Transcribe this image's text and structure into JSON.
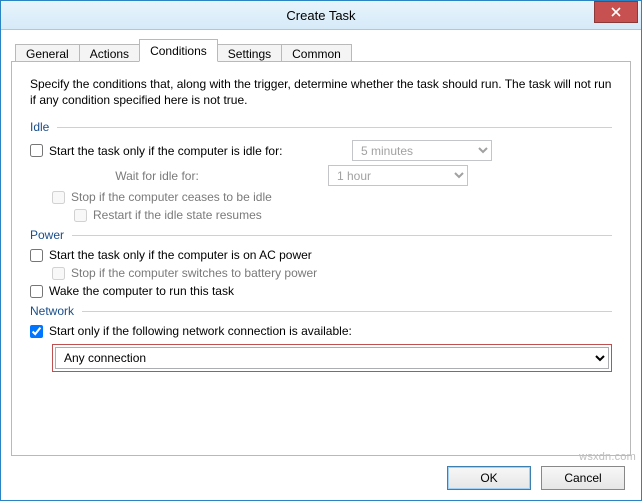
{
  "window": {
    "title": "Create Task"
  },
  "tabs": {
    "general": "General",
    "actions": "Actions",
    "conditions": "Conditions",
    "settings": "Settings",
    "common": "Common"
  },
  "intro": "Specify the conditions that, along with the trigger, determine whether the task should run. The task will not run if any condition specified here is not true.",
  "sections": {
    "idle": "Idle",
    "power": "Power",
    "network": "Network"
  },
  "idle": {
    "start_label": "Start the task only if the computer is idle for:",
    "idle_duration": "5 minutes",
    "wait_label": "Wait for idle for:",
    "wait_duration": "1 hour",
    "stop_label": "Stop if the computer ceases to be idle",
    "restart_label": "Restart if the idle state resumes"
  },
  "power": {
    "ac_label": "Start the task only if the computer is on AC power",
    "battery_label": "Stop if the computer switches to battery power",
    "wake_label": "Wake the computer to run this task"
  },
  "network": {
    "start_label": "Start only if the following network connection is available:",
    "connection": "Any connection"
  },
  "buttons": {
    "ok": "OK",
    "cancel": "Cancel"
  },
  "watermark": "wsxdn.com"
}
